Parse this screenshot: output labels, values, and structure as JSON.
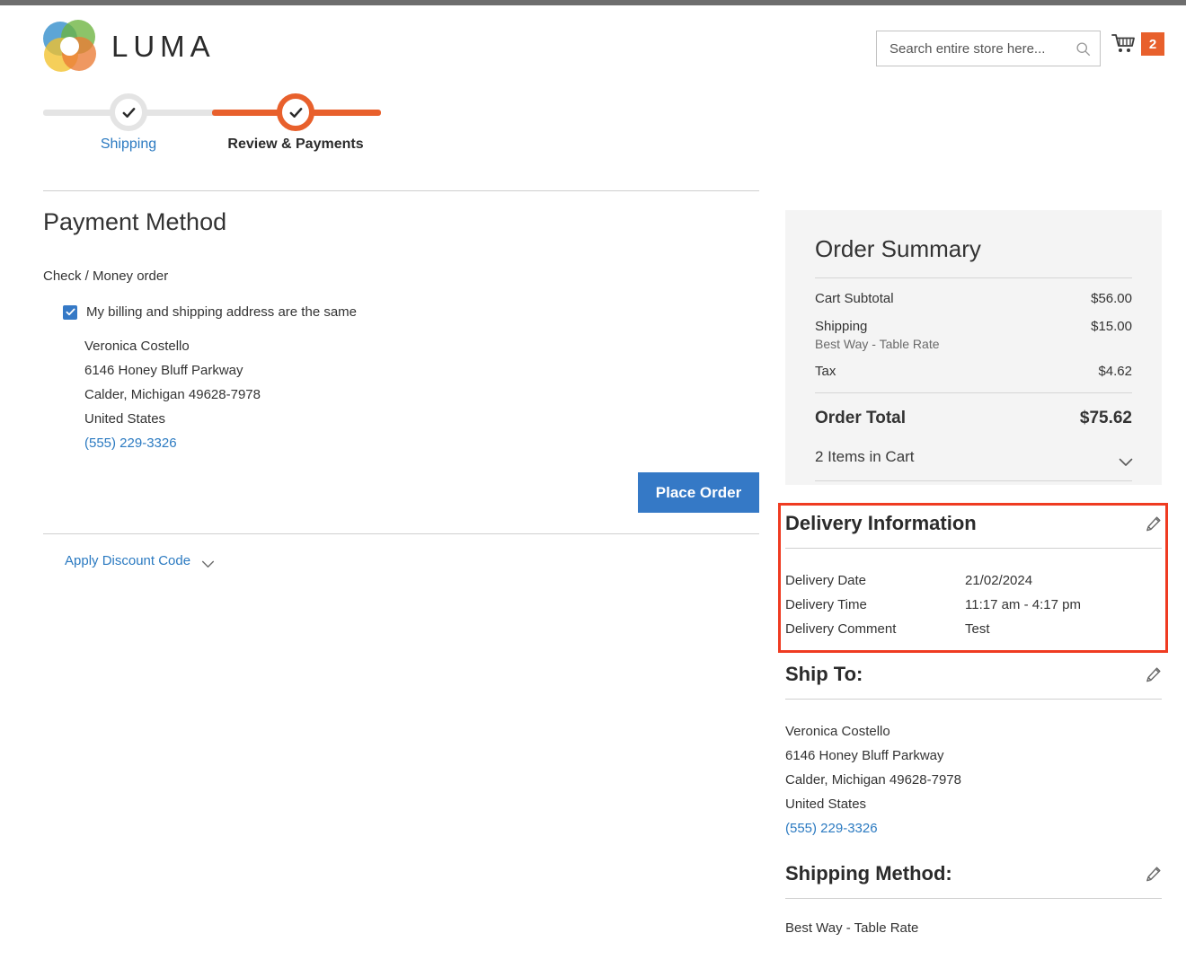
{
  "header": {
    "logo_text": "LUMA",
    "logo_icon": "luma-flower-logo",
    "search": {
      "placeholder": "Search entire store here...",
      "value": "",
      "icon": "search-icon"
    },
    "cart": {
      "icon": "shopping-cart-icon",
      "count": "2"
    }
  },
  "progress": {
    "steps": [
      {
        "label": "Shipping",
        "state": "completed",
        "icon": "check-icon"
      },
      {
        "label": "Review & Payments",
        "state": "active",
        "icon": "check-icon"
      }
    ]
  },
  "payment": {
    "title": "Payment Method",
    "method_name": "Check / Money order",
    "billing_same_label": "My billing and shipping address are the same",
    "billing_same_checked": true,
    "billing_address": {
      "name": "Veronica Costello",
      "street": "6146 Honey Bluff Parkway",
      "city_state_zip": "Calder, Michigan 49628-7978",
      "country": "United States",
      "phone": "(555) 229-3326"
    },
    "place_order_label": "Place Order",
    "discount_label": "Apply Discount Code",
    "discount_icon": "chevron-down-icon"
  },
  "order_summary": {
    "title": "Order Summary",
    "rows": [
      {
        "label": "Cart Subtotal",
        "sub": "",
        "value": "$56.00"
      },
      {
        "label": "Shipping",
        "sub": "Best Way - Table Rate",
        "value": "$15.00"
      },
      {
        "label": "Tax",
        "sub": "",
        "value": "$4.62"
      }
    ],
    "total_label": "Order Total",
    "total_value": "$75.62",
    "items_label": "2 Items in Cart",
    "items_icon": "chevron-down-icon"
  },
  "delivery_information": {
    "title": "Delivery Information",
    "edit_icon": "pencil-icon",
    "fields": [
      {
        "key": "Delivery Date",
        "value": "21/02/2024"
      },
      {
        "key": "Delivery Time",
        "value": "11:17 am - 4:17 pm"
      },
      {
        "key": "Delivery Comment",
        "value": "Test"
      }
    ],
    "highlight_color": "#ef3b21"
  },
  "ship_to": {
    "title": "Ship To:",
    "edit_icon": "pencil-icon",
    "name": "Veronica Costello",
    "street": "6146 Honey Bluff Parkway",
    "city_state_zip": "Calder, Michigan 49628-7978",
    "country": "United States",
    "phone": "(555) 229-3326"
  },
  "shipping_method": {
    "title": "Shipping Method:",
    "edit_icon": "pencil-icon",
    "value": "Best Way - Table Rate"
  },
  "colors": {
    "accent_orange": "#e8602c",
    "link_blue": "#2b7ac1",
    "button_blue": "#3579c6",
    "summary_bg": "#f4f4f4"
  }
}
